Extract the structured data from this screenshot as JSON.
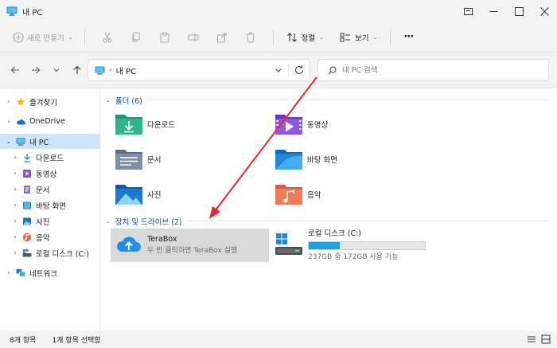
{
  "window": {
    "title": "내 PC"
  },
  "toolbar": {
    "new_label": "새로 만들기",
    "sort_label": "정렬",
    "view_label": "보기",
    "more_label": "···"
  },
  "address": {
    "crumb": "내 PC"
  },
  "search": {
    "placeholder": "내 PC 검색"
  },
  "sidebar": {
    "items": [
      {
        "label": "즐겨찾기"
      },
      {
        "label": "OneDrive"
      },
      {
        "label": "내 PC"
      },
      {
        "label": "다운로드"
      },
      {
        "label": "동영상"
      },
      {
        "label": "문서"
      },
      {
        "label": "바탕 화면"
      },
      {
        "label": "사진"
      },
      {
        "label": "음악"
      },
      {
        "label": "로컬 디스크 (C:)"
      },
      {
        "label": "네트워크"
      }
    ]
  },
  "folders_section": {
    "header": "폴더 (6)",
    "items": [
      {
        "label": "다운로드",
        "icon": "download-folder-icon"
      },
      {
        "label": "동영상",
        "icon": "videos-folder-icon"
      },
      {
        "label": "문서",
        "icon": "documents-folder-icon"
      },
      {
        "label": "바탕 화면",
        "icon": "desktop-folder-icon"
      },
      {
        "label": "사진",
        "icon": "pictures-folder-icon"
      },
      {
        "label": "음악",
        "icon": "music-folder-icon"
      }
    ]
  },
  "drives_section": {
    "header": "장치 및 드라이브 (2)",
    "terabox": {
      "name": "TeraBox",
      "subtitle": "두 번 클릭하면 TeraBox 실행"
    },
    "local_disk": {
      "name": "로컬 디스크 (C:)",
      "usage": "237GB 중 172GB 사용 가능",
      "used_fraction": 0.27
    }
  },
  "status": {
    "item_count": "8개 항목",
    "selected": "1개 항목 선택함"
  },
  "colors": {
    "accent": "#26a0da",
    "selection": "#cde6f7",
    "arrow": "#e8262b"
  }
}
